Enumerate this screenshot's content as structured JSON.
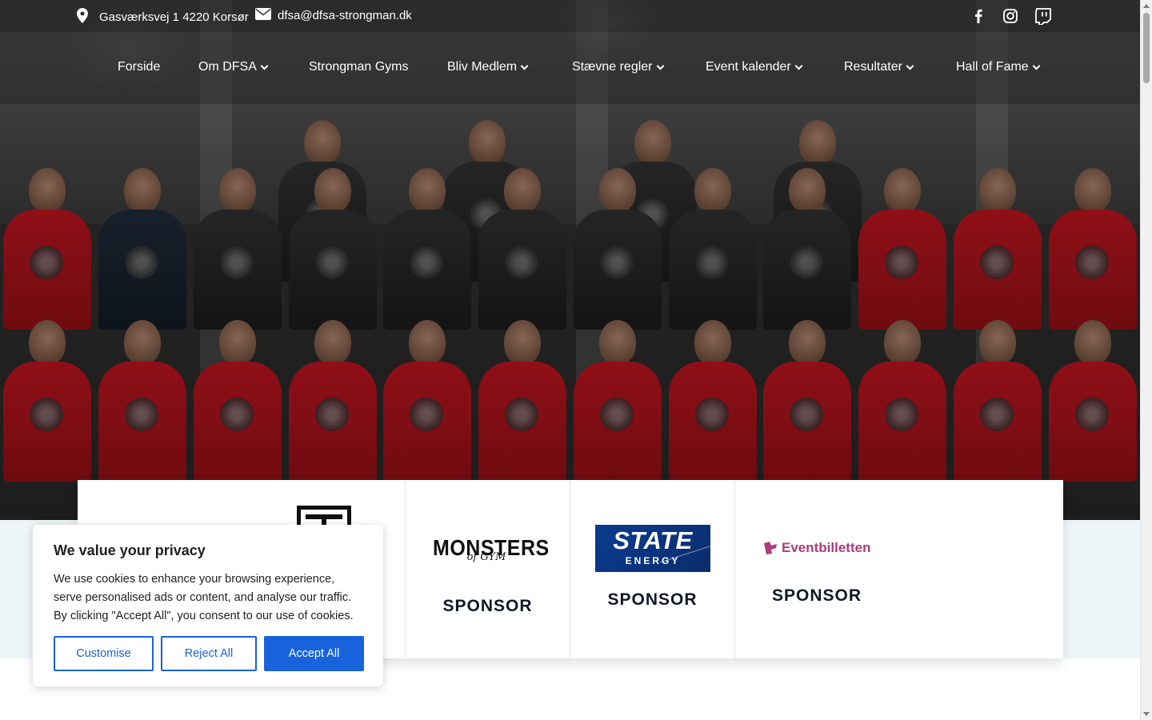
{
  "topbar": {
    "address": "Gasværksvej 1 4220 Korsør",
    "address_icon": "map-pin-icon",
    "email": "dfsa@dfsa-strongman.dk",
    "email_icon": "envelope-icon",
    "social": [
      "facebook-icon",
      "instagram-icon",
      "twitch-icon"
    ]
  },
  "nav": {
    "items": [
      {
        "label": "Forside",
        "dropdown": false
      },
      {
        "label": "Om DFSA",
        "dropdown": true
      },
      {
        "label": "Strongman Gyms",
        "dropdown": false
      },
      {
        "label": "Bliv Medlem",
        "dropdown": true
      },
      {
        "label": "Stævne regler",
        "dropdown": true
      },
      {
        "label": "Event kalender",
        "dropdown": true
      },
      {
        "label": "Resultater",
        "dropdown": true
      },
      {
        "label": "Hall of Fame",
        "dropdown": true
      }
    ]
  },
  "sponsors": {
    "items": [
      {
        "logo_text": "",
        "title": ""
      },
      {
        "logo_text": "MONSTERS",
        "logo_sub": "of GYM",
        "title": "SPONSOR"
      },
      {
        "logo_text": "STATE",
        "logo_sub": "ENERGY",
        "title": "SPONSOR"
      },
      {
        "logo_text": "Eventbilletten",
        "title": "SPONSOR"
      }
    ]
  },
  "cookie": {
    "title": "We value your privacy",
    "body": "We use cookies to enhance your browsing experience, serve personalised ads or content, and analyse our traffic. By clicking \"Accept All\", you consent to our use of cookies.",
    "customise": "Customise",
    "reject": "Reject All",
    "accept": "Accept All"
  },
  "colors": {
    "accent": "#1863dc",
    "shirt_red": "#a5121b",
    "state_blue": "#0a3a8c",
    "eventbilletten_pink": "#b03a7a"
  }
}
